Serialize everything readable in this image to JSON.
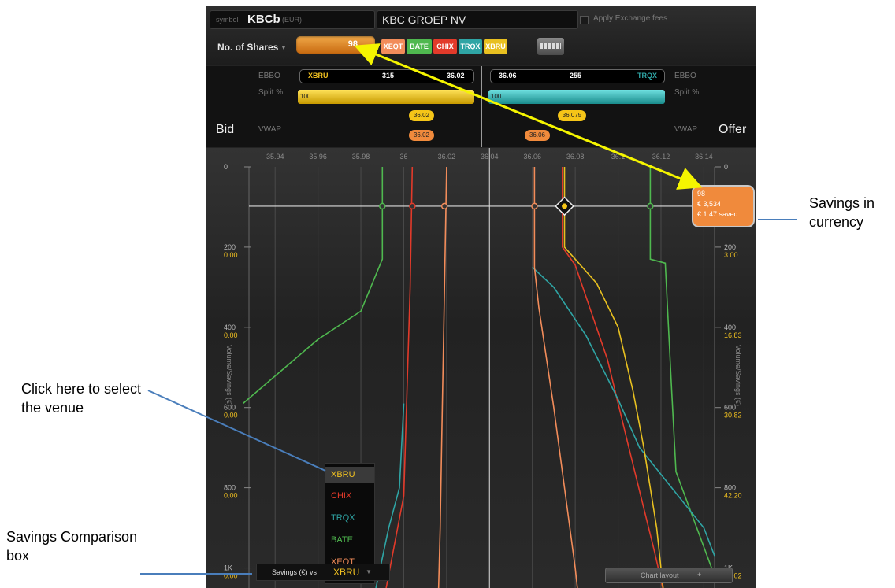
{
  "header": {
    "symbol_label": "symbol",
    "symbol": "KBCb",
    "currency": "(EUR)",
    "company": "KBC GROEP NV",
    "fees_label": "Apply Exchange fees",
    "shares_mode": "No. of Shares",
    "shares_value": "98",
    "venues": [
      {
        "label": "XEQT",
        "color": "#f28c5a"
      },
      {
        "label": "BATE",
        "color": "#4fb84f"
      },
      {
        "label": "CHIX",
        "color": "#e23a2a"
      },
      {
        "label": "TRQX",
        "color": "#2fa5a5"
      },
      {
        "label": "XBRU",
        "color": "#e8c020"
      }
    ],
    "settings_icon": "grid-icon"
  },
  "quote": {
    "bid_label": "Bid",
    "offer_label": "Offer",
    "ebbo_label": "EBBO",
    "split_label": "Split %",
    "vwap_label": "VWAP",
    "bid": {
      "venue": "XBRU",
      "size": "315",
      "price": "36.02",
      "split": "100",
      "split_fraction": 1.0
    },
    "offer": {
      "price": "36.06",
      "size": "255",
      "venue": "TRQX",
      "split": "100",
      "split_fraction": 1.0
    },
    "vwap_pills": [
      {
        "value": "36.02",
        "color": "#f5c518"
      },
      {
        "value": "36.02",
        "color": "#f08a3c"
      },
      {
        "value": "36.075",
        "color": "#f5c518"
      },
      {
        "value": "36.06",
        "color": "#f08a3c"
      }
    ]
  },
  "chart_data": {
    "type": "line",
    "x_ticks": [
      "35.94",
      "35.96",
      "35.98",
      "36",
      "36.02",
      "36.04",
      "36.06",
      "36.08",
      "36.1",
      "36.12",
      "36.14"
    ],
    "x_range": [
      35.93,
      36.145
    ],
    "y_range": [
      0,
      1050
    ],
    "y_left_label": "Volume/Savings (€)",
    "y_right_label": "Volume/Savings (€)",
    "y_ticks": [
      {
        "volume": 0,
        "label": "0",
        "left_saving": "",
        "right_saving": ""
      },
      {
        "volume": 200,
        "label": "200",
        "left_saving": "0.00",
        "right_saving": "3.00"
      },
      {
        "volume": 400,
        "label": "400",
        "left_saving": "0.00",
        "right_saving": "16.83"
      },
      {
        "volume": 600,
        "label": "600",
        "left_saving": "0.00",
        "right_saving": "30.82"
      },
      {
        "volume": 800,
        "label": "800",
        "left_saving": "0.00",
        "right_saving": "42.20"
      },
      {
        "volume": 1000,
        "label": "1K",
        "left_saving": "0.00",
        "right_saving": "50.02"
      }
    ],
    "marker_volume": 98,
    "marker_price": 36.075,
    "series": [
      {
        "name": "BATE",
        "color": "#4fb84f",
        "points": [
          [
            35.99,
            0
          ],
          [
            35.99,
            230
          ],
          [
            35.98,
            360
          ],
          [
            35.96,
            430
          ],
          [
            35.925,
            590
          ]
        ]
      },
      {
        "name": "BATE",
        "color": "#4fb84f",
        "points": [
          [
            36.115,
            0
          ],
          [
            36.115,
            230
          ],
          [
            36.122,
            240
          ],
          [
            36.125,
            560
          ],
          [
            36.127,
            760
          ],
          [
            36.145,
            1020
          ]
        ]
      },
      {
        "name": "CHIX",
        "color": "#e23a2a",
        "points": [
          [
            36.004,
            0
          ],
          [
            36.003,
            300
          ],
          [
            36.0,
            820
          ],
          [
            35.99,
            1100
          ]
        ]
      },
      {
        "name": "CHIX",
        "color": "#e23a2a",
        "points": [
          [
            36.074,
            0
          ],
          [
            36.074,
            200
          ],
          [
            36.08,
            245
          ],
          [
            36.095,
            480
          ],
          [
            36.105,
            700
          ],
          [
            36.117,
            960
          ],
          [
            36.123,
            1100
          ]
        ]
      },
      {
        "name": "TRQX",
        "color": "#2fa5a5",
        "points": [
          [
            36.06,
            250
          ],
          [
            36.07,
            300
          ],
          [
            36.085,
            420
          ],
          [
            36.1,
            580
          ],
          [
            36.11,
            700
          ],
          [
            36.14,
            900
          ],
          [
            36.145,
            970
          ]
        ]
      },
      {
        "name": "TRQX",
        "color": "#2fa5a5",
        "points": [
          [
            36.0,
            590
          ],
          [
            35.998,
            800
          ],
          [
            35.993,
            900
          ],
          [
            35.985,
            1100
          ]
        ]
      },
      {
        "name": "XBRU",
        "color": "#e8c020",
        "points": [
          [
            36.075,
            0
          ],
          [
            36.075,
            200
          ],
          [
            36.09,
            290
          ],
          [
            36.1,
            400
          ],
          [
            36.107,
            560
          ],
          [
            36.112,
            700
          ],
          [
            36.118,
            900
          ],
          [
            36.122,
            1100
          ]
        ]
      },
      {
        "name": "XEQT",
        "color": "#f28c5a",
        "points": [
          [
            36.02,
            0
          ],
          [
            36.019,
            300
          ],
          [
            36.018,
            600
          ],
          [
            36.017,
            900
          ],
          [
            36.016,
            1100
          ]
        ]
      },
      {
        "name": "XEQT",
        "color": "#f28c5a",
        "points": [
          [
            36.061,
            0
          ],
          [
            36.061,
            250
          ],
          [
            36.063,
            350
          ],
          [
            36.07,
            600
          ],
          [
            36.075,
            800
          ],
          [
            36.08,
            1000
          ],
          [
            36.082,
            1100
          ]
        ]
      }
    ],
    "dots": [
      {
        "price": 35.99,
        "color": "#4fb84f"
      },
      {
        "price": 36.004,
        "color": "#e23a2a"
      },
      {
        "price": 36.019,
        "color": "#f28c5a"
      },
      {
        "price": 36.061,
        "color": "#f28c5a"
      },
      {
        "price": 36.115,
        "color": "#4fb84f"
      }
    ],
    "tooltip": {
      "shares": "98",
      "amount": "€ 3,534",
      "saved": "€ 1.47 saved"
    }
  },
  "venue_menu": [
    {
      "label": "XBRU",
      "color": "#f0c020",
      "selected": true
    },
    {
      "label": "CHIX",
      "color": "#e23a2a",
      "selected": false
    },
    {
      "label": "TRQX",
      "color": "#2fa5a5",
      "selected": false
    },
    {
      "label": "BATE",
      "color": "#4fb84f",
      "selected": false
    },
    {
      "label": "XEQT",
      "color": "#f28c5a",
      "selected": false
    }
  ],
  "savings": {
    "label": "Savings (€) vs",
    "venue": "XBRU"
  },
  "chart_layout_label": "Chart layout",
  "annotations": {
    "savings_currency": [
      "Savings in",
      "currency"
    ],
    "select_venue": [
      "Click here to select",
      "the venue"
    ],
    "comparison_box": [
      "Savings Comparison",
      "box"
    ]
  }
}
